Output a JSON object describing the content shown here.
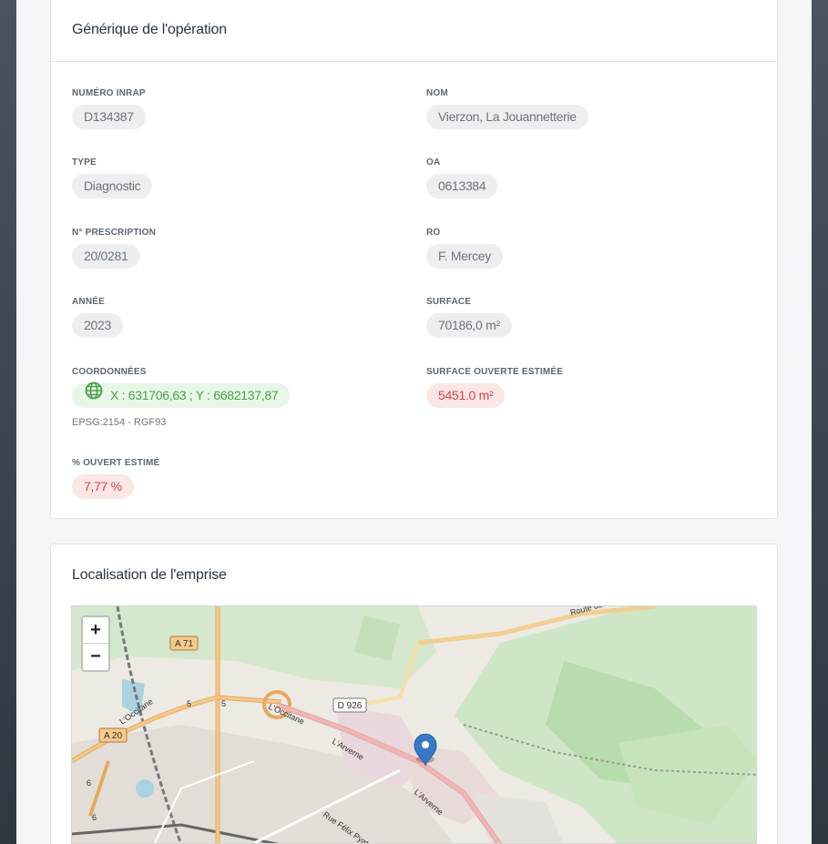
{
  "general": {
    "title": "Générique de l'opération",
    "fields": {
      "numero_inrap": {
        "label": "NUMÉRO INRAP",
        "value": "D134387"
      },
      "nom": {
        "label": "NOM",
        "value": "Vierzon, La Jouannetterie"
      },
      "type": {
        "label": "TYPE",
        "value": "Diagnostic"
      },
      "oa": {
        "label": "OA",
        "value": "0613384"
      },
      "prescription": {
        "label": "N° PRESCRIPTION",
        "value": "20/0281"
      },
      "ro": {
        "label": "RO",
        "value": "F. Mercey"
      },
      "annee": {
        "label": "ANNÉE",
        "value": "2023"
      },
      "surface": {
        "label": "SURFACE",
        "value": "70186,0 m²"
      },
      "coordonnees": {
        "label": "COORDONNÉES",
        "value": "X : 631706,63 ; Y : 6682137,87",
        "projection": "EPSG:2154 - RGF93",
        "icon": "globe-icon"
      },
      "surface_ouverte": {
        "label": "SURFACE OUVERTE ESTIMÉE",
        "value": "5451.0 m²"
      },
      "pct_ouvert": {
        "label": "% OUVERT ESTIMÉ",
        "value": "7,77 %"
      }
    }
  },
  "map": {
    "title": "Localisation de l'emprise",
    "zoom_in": "+",
    "zoom_out": "−",
    "labels": {
      "a71": "A 71",
      "a20": "A 20",
      "d926": "D 926",
      "occitane1": "L'Occitane",
      "occitane2": "L'Occitane",
      "arverne1": "L'Arverne",
      "arverne2": "L'Arverne",
      "felix_pyat": "Rue Félix Pyat",
      "route_de": "Route de",
      "exit5a": "5",
      "exit5b": "5",
      "exit6a": "6",
      "exit6b": "6"
    }
  },
  "colors": {
    "green_text": "#4aa04a",
    "red_text": "#d64545",
    "marker": "#3878c7"
  }
}
